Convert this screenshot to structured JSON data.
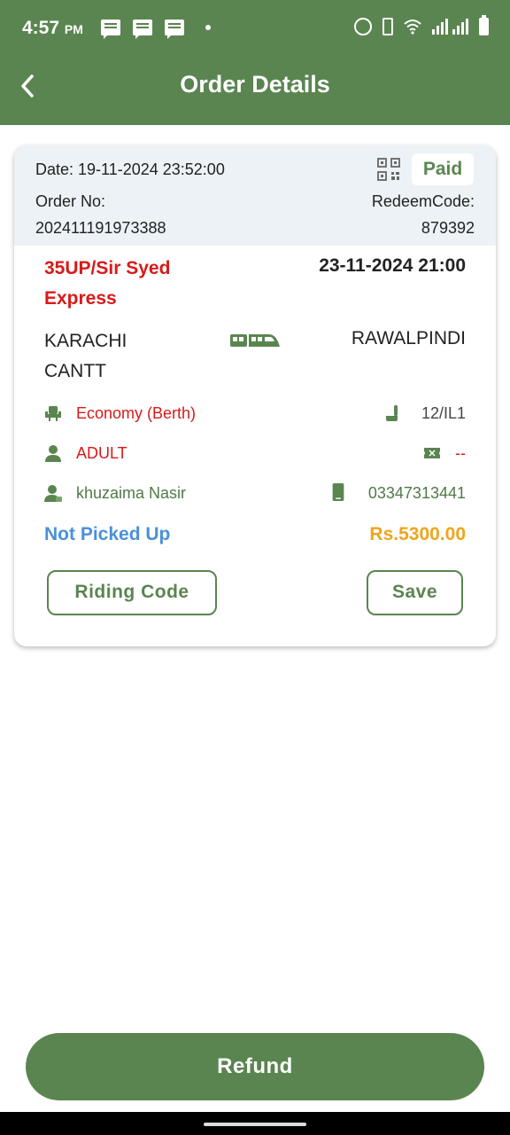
{
  "status_bar": {
    "time": "4:57",
    "ampm": "PM"
  },
  "app_bar": {
    "title": "Order Details"
  },
  "order": {
    "date_label": "Date: 19-11-2024 23:52:00",
    "payment_status": "Paid",
    "order_no_label": "Order No:",
    "order_no": "202411191973388",
    "redeem_label": "RedeemCode:",
    "redeem_code": "879392",
    "train_name": "35UP/Sir Syed Express",
    "departure": "23-11-2024 21:00",
    "from": "KARACHI CANTT",
    "to": "RAWALPINDI",
    "class": "Economy (Berth)",
    "seat": "12/IL1",
    "passenger_type": "ADULT",
    "ticket_extra": "--",
    "passenger_name": "khuzaima Nasir",
    "phone": "03347313441",
    "pickup_status": "Not Picked Up",
    "price": "Rs.5300.00"
  },
  "actions": {
    "riding_code": "Riding Code",
    "save": "Save",
    "refund": "Refund"
  },
  "colors": {
    "primary": "#5a8550",
    "accent_red": "#d81a1a",
    "status_blue": "#4a90d9",
    "price_orange": "#f0a51c"
  },
  "icons": [
    "back-arrow-icon",
    "qr-code-icon",
    "train-icon",
    "seat-icon",
    "berth-icon",
    "person-icon",
    "ticket-icon",
    "user-badge-icon",
    "phone-icon"
  ]
}
